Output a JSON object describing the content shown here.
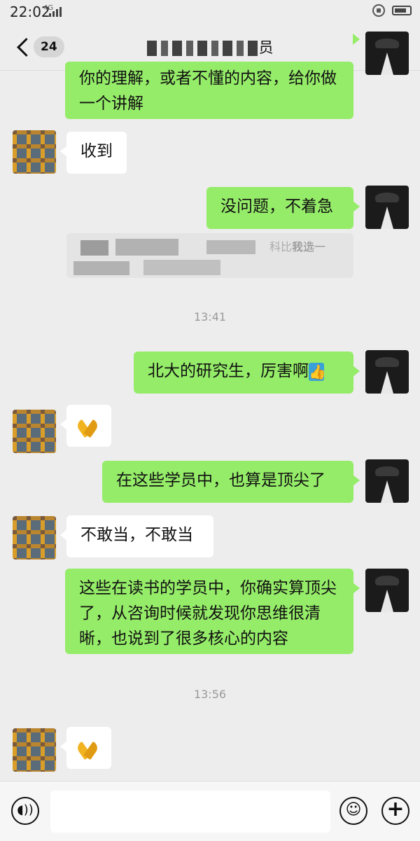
{
  "status_bar": {
    "time": "22:02",
    "network": "4G"
  },
  "header": {
    "back_count": "24",
    "title": "员",
    "more": "···"
  },
  "messages": [
    {
      "dir": "out",
      "text": "你的理解，或者不懂的内容，给你做一个讲解"
    },
    {
      "dir": "in",
      "text": "收到"
    },
    {
      "dir": "out",
      "text": "没问题，不着急"
    },
    {
      "dir": "in",
      "text_fragments": [
        "科比较少",
        "我选一"
      ]
    },
    {
      "dir": "out",
      "text": "北大的研究生，厉害啊"
    },
    {
      "dir": "in",
      "emoji": "folded-hands"
    },
    {
      "dir": "out",
      "text": "在这些学员中，也算是顶尖了"
    },
    {
      "dir": "in",
      "text": "不敢当，不敢当"
    },
    {
      "dir": "out",
      "text": "这些在读书的学员中，你确实算顶尖了，从咨询时候就发现你思维很清晰，也说到了很多核心的内容"
    },
    {
      "dir": "in",
      "emoji": "folded-hands"
    }
  ],
  "timestamps": [
    "13:41",
    "13:56"
  ],
  "input": {
    "placeholder": ""
  }
}
